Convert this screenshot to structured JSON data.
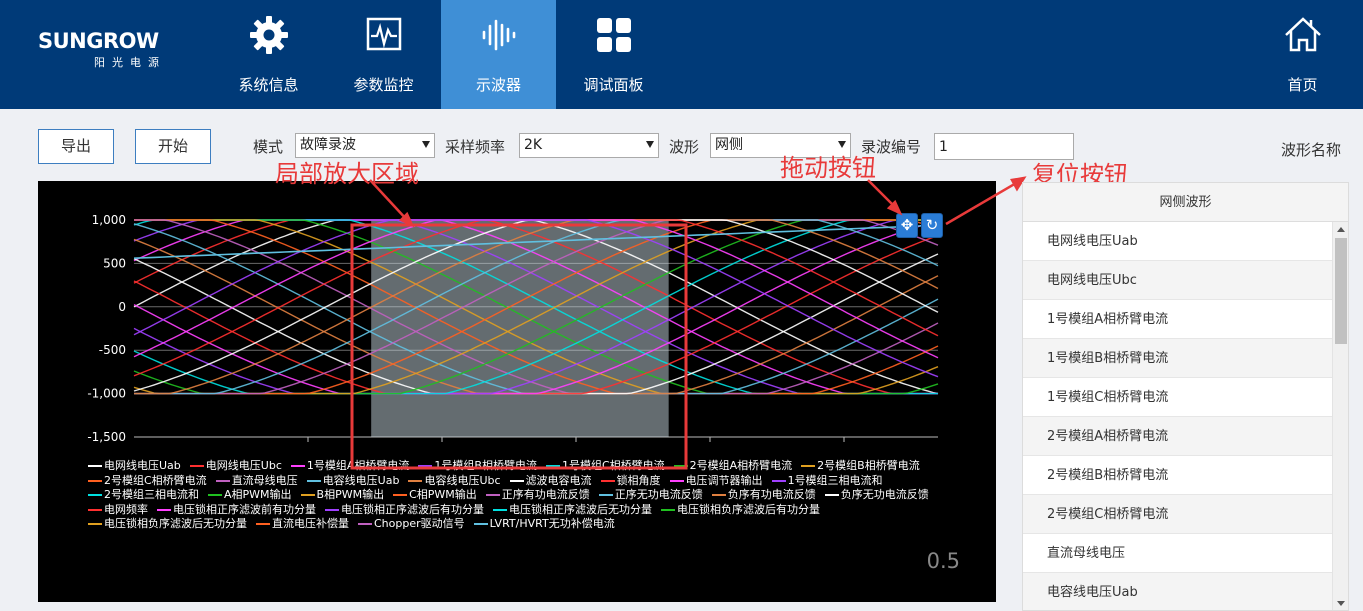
{
  "brand": {
    "name": "SUNGROW",
    "sub": "阳光电源"
  },
  "nav": {
    "items": [
      {
        "label": "系统信息",
        "icon": "gear-icon"
      },
      {
        "label": "参数监控",
        "icon": "monitor-icon"
      },
      {
        "label": "示波器",
        "icon": "waveform-icon",
        "active": true
      },
      {
        "label": "调试面板",
        "icon": "grid-icon"
      }
    ],
    "home": {
      "label": "首页",
      "icon": "home-icon"
    }
  },
  "toolbar": {
    "export_label": "导出",
    "start_label": "开始",
    "mode_label": "模式",
    "mode_value": "故障录波",
    "rate_label": "采样频率",
    "rate_value": "2K",
    "wave_label": "波形",
    "wave_value": "网侧",
    "record_label": "录波编号",
    "record_value": "1",
    "wave_name_label": "波形名称"
  },
  "annotations": {
    "zoom_region": "局部放大区域",
    "drag_button": "拖动按钮",
    "reset_button": "复位按钮",
    "color": "#e83a3a"
  },
  "chart_data": {
    "type": "line",
    "y_ticks": [
      "1,000",
      "500",
      "0",
      "-500",
      "-1,000",
      "-1,500"
    ],
    "ylim": [
      -1500,
      1000
    ],
    "grid": true,
    "selection": {
      "x_start": 0.295,
      "x_end": 0.665
    },
    "zoom_value": "0.5",
    "legend": [
      {
        "name": "电网线电压Uab",
        "color": "#ffffff"
      },
      {
        "name": "电网线电压Ubc",
        "color": "#ff3030"
      },
      {
        "name": "1号模组A相桥臂电流",
        "color": "#ff40ff"
      },
      {
        "name": "1号模组B相桥臂电流",
        "color": "#a040ff"
      },
      {
        "name": "1号模组C相桥臂电流",
        "color": "#00e0e0"
      },
      {
        "name": "2号模组A相桥臂电流",
        "color": "#20c020"
      },
      {
        "name": "2号模组B相桥臂电流",
        "color": "#e0a020"
      },
      {
        "name": "2号模组C相桥臂电流",
        "color": "#ff6020"
      },
      {
        "name": "直流母线电压",
        "color": "#c060c0"
      },
      {
        "name": "电容线电压Uab",
        "color": "#60c0e0"
      },
      {
        "name": "电容线电压Ubc",
        "color": "#e08040"
      },
      {
        "name": "滤波电容电流",
        "color": "#ffffff"
      },
      {
        "name": "锁相角度",
        "color": "#ff3030"
      },
      {
        "name": "电压调节器输出",
        "color": "#ff40ff"
      },
      {
        "name": "1号模组三相电流和",
        "color": "#a040ff"
      },
      {
        "name": "2号模组三相电流和",
        "color": "#00e0e0"
      },
      {
        "name": "A相PWM输出",
        "color": "#20c020"
      },
      {
        "name": "B相PWM输出",
        "color": "#e0a020"
      },
      {
        "name": "C相PWM输出",
        "color": "#ff6020"
      },
      {
        "name": "正序有功电流反馈",
        "color": "#c060c0"
      },
      {
        "name": "正序无功电流反馈",
        "color": "#60c0e0"
      },
      {
        "name": "负序有功电流反馈",
        "color": "#e08040"
      },
      {
        "name": "负序无功电流反馈",
        "color": "#ffffff"
      },
      {
        "name": "电网频率",
        "color": "#ff3030"
      },
      {
        "name": "电压锁相正序滤波前有功分量",
        "color": "#ff40ff"
      },
      {
        "name": "电压锁相正序滤波后有功分量",
        "color": "#a040ff"
      },
      {
        "name": "电压锁相正序滤波后无功分量",
        "color": "#00e0e0"
      },
      {
        "name": "电压锁相负序滤波后有功分量",
        "color": "#20c020"
      },
      {
        "name": "电压锁相负序滤波后无功分量",
        "color": "#e0a020"
      },
      {
        "name": "直流电压补偿量",
        "color": "#ff6020"
      },
      {
        "name": "Chopper驱动信号",
        "color": "#c060c0"
      },
      {
        "name": "LVRT/HVRT无功补偿电流",
        "color": "#60c0e0"
      }
    ]
  },
  "wave_list": {
    "header": "网侧波形",
    "items": [
      "电网线电压Uab",
      "电网线电压Ubc",
      "1号模组A相桥臂电流",
      "1号模组B相桥臂电流",
      "1号模组C相桥臂电流",
      "2号模组A相桥臂电流",
      "2号模组B相桥臂电流",
      "2号模组C相桥臂电流",
      "直流母线电压",
      "电容线电压Uab"
    ]
  }
}
